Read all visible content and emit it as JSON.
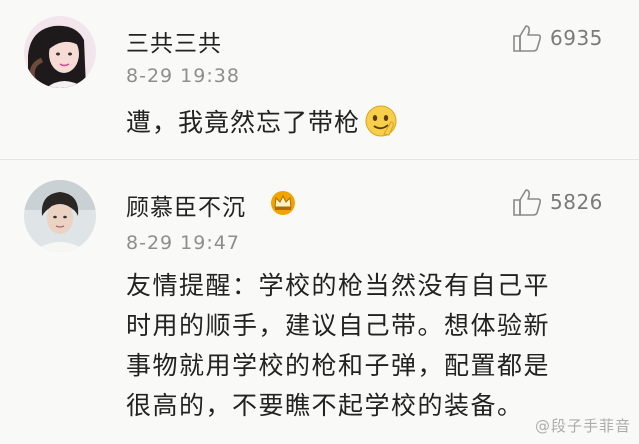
{
  "comments": [
    {
      "username": "三共三共",
      "timestamp": "8-29 19:38",
      "likes": "6935",
      "text": "遭，我竟然忘了带枪",
      "emoji": "cheeky-face-emoji"
    },
    {
      "username": "顾慕臣不沉",
      "timestamp": "8-29 19:47",
      "likes": "5826",
      "badge": "crown-badge",
      "lines": [
        "友情提醒：学校的枪当然没有自己平",
        "时用的顺手，建议自己带。想体验新",
        "事物就用学校的枪和子弹，配置都是",
        "很高的，不要瞧不起学校的装备。"
      ]
    }
  ],
  "watermark": "@段子手菲音",
  "colors": {
    "background": "#f9f9f7",
    "text": "#222222",
    "meta": "#8e8e8e",
    "badge": "#e8a200"
  }
}
